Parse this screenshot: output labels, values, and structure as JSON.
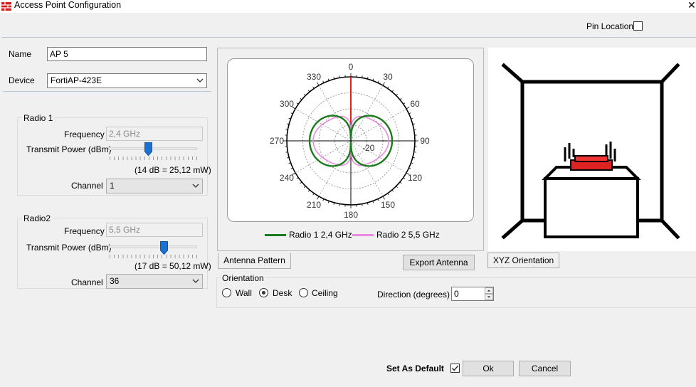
{
  "window": {
    "title": "Access Point Configuration",
    "close_glyph": "✕"
  },
  "header": {
    "pin_location_label": "Pin Location",
    "pin_location_checked": false
  },
  "form": {
    "name_label": "Name",
    "name_value": "AP 5",
    "device_label": "Device",
    "device_value": "FortiAP-423E"
  },
  "radio1": {
    "title": "Radio 1",
    "frequency_label": "Frequency",
    "frequency_value": "2,4 GHz",
    "power_label": "Transmit Power (dBm)",
    "power_fraction": 0.45,
    "power_readout": "(14 dB = 25,12 mW)",
    "channel_label": "Channel",
    "channel_value": "1"
  },
  "radio2": {
    "title": "Radio2",
    "frequency_label": "Frequency",
    "frequency_value": "5,5 GHz",
    "power_label": "Transmit Power (dBm)",
    "power_fraction": 0.63,
    "power_readout": "(17 dB = 50,12 mW)",
    "channel_label": "Channel",
    "channel_value": "36"
  },
  "antenna": {
    "angle_labels": [
      "0",
      "30",
      "60",
      "90",
      "120",
      "150",
      "180",
      "210",
      "240",
      "270",
      "300",
      "330"
    ],
    "radial_label": "-20",
    "legend": [
      {
        "name": "Radio 1 2,4 GHz",
        "color": "#1c7a1c"
      },
      {
        "name": "Radio 2 5,5 GHz",
        "color": "#e88ae0"
      }
    ],
    "direction_marker_color": "#e02020"
  },
  "tabs": {
    "antenna_pattern": "Antenna Pattern",
    "xyz_orientation": "XYZ Orientation"
  },
  "export_button": "Export Antenna",
  "orientation": {
    "title": "Orientation",
    "options": [
      "Wall",
      "Desk",
      "Ceiling"
    ],
    "selected": "Desk",
    "direction_label": "Direction (degrees)",
    "direction_value": "0"
  },
  "footer": {
    "set_default_label": "Set As Default",
    "set_default_checked": true,
    "ok_label": "Ok",
    "cancel_label": "Cancel"
  },
  "icons": [
    "app-icon",
    "close-icon",
    "chevron-down-icon",
    "check-icon",
    "spin-up-icon",
    "spin-down-icon"
  ]
}
